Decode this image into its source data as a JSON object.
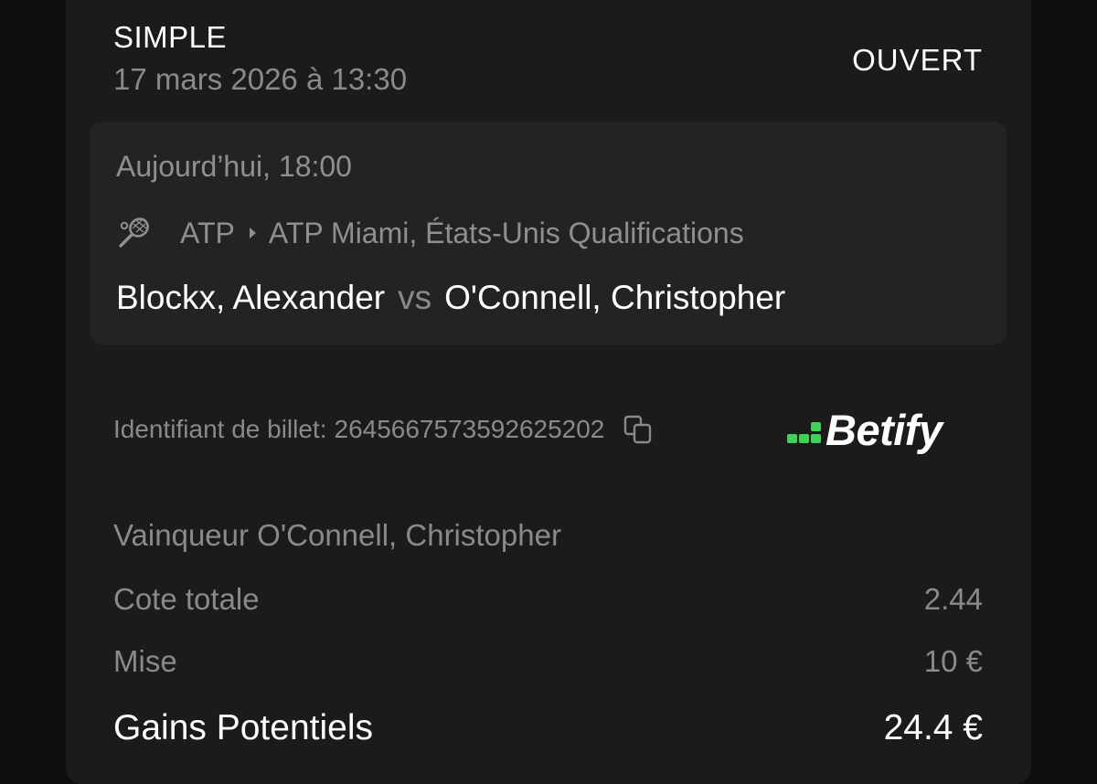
{
  "bet": {
    "type": "SIMPLE",
    "date": "17 mars 2026 à 13:30",
    "status": "OUVERT"
  },
  "event": {
    "time": "Aujourd’hui, 18:00",
    "sport_icon": "tennis-racket-icon",
    "category": "ATP",
    "competition": "ATP Miami, États-Unis Qualifications",
    "home": "Blockx, Alexander",
    "vs": "vs",
    "away": "O'Connell, Christopher"
  },
  "ticket": {
    "label": "Identifiant de billet:",
    "id": "2645667573592625202",
    "copy_icon": "copy-icon"
  },
  "brand": {
    "name": "Betify",
    "accent": "#3fd15a"
  },
  "selection": "Vainqueur O'Connell, Christopher",
  "summary": {
    "odds_label": "Cote totale",
    "odds_value": "2.44",
    "stake_label": "Mise",
    "stake_value": "10 €",
    "payout_label": "Gains Potentiels",
    "payout_value": "24.4 €"
  }
}
